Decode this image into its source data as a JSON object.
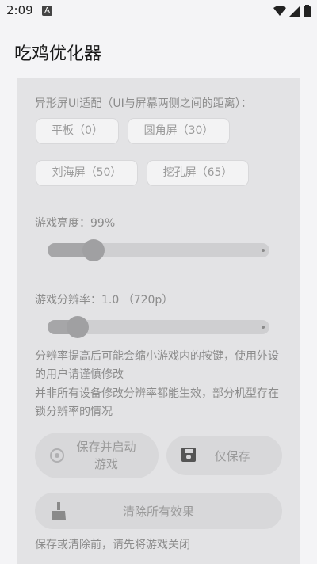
{
  "status_bar": {
    "time": "2:09",
    "notif": "A"
  },
  "app_bar": {
    "title": "吃鸡优化器"
  },
  "screen_fit": {
    "label": "异形屏UI适配（UI与屏幕两侧之间的距离）：",
    "options": [
      "平板（0）",
      "圆角屏（30）",
      "刘海屏（50）",
      "挖孔屏（65）"
    ]
  },
  "brightness": {
    "label": "游戏亮度：99%",
    "value_fraction": 0.99
  },
  "resolution": {
    "label": "游戏分辨率：1.0 （720p）",
    "value": 1.0
  },
  "notes": {
    "line1": "分辨率提高后可能会缩小游戏内的按键，使用外设的用户请谨慎修改",
    "line2": "并非所有设备修改分辨率都能生效，部分机型存在锁分辨率的情况"
  },
  "buttons": {
    "save_launch": "保存并启动\n游戏",
    "save_only": "仅保存",
    "clear_all": "清除所有效果"
  },
  "footer": {
    "note": "保存或清除前，请先将游戏关闭"
  }
}
